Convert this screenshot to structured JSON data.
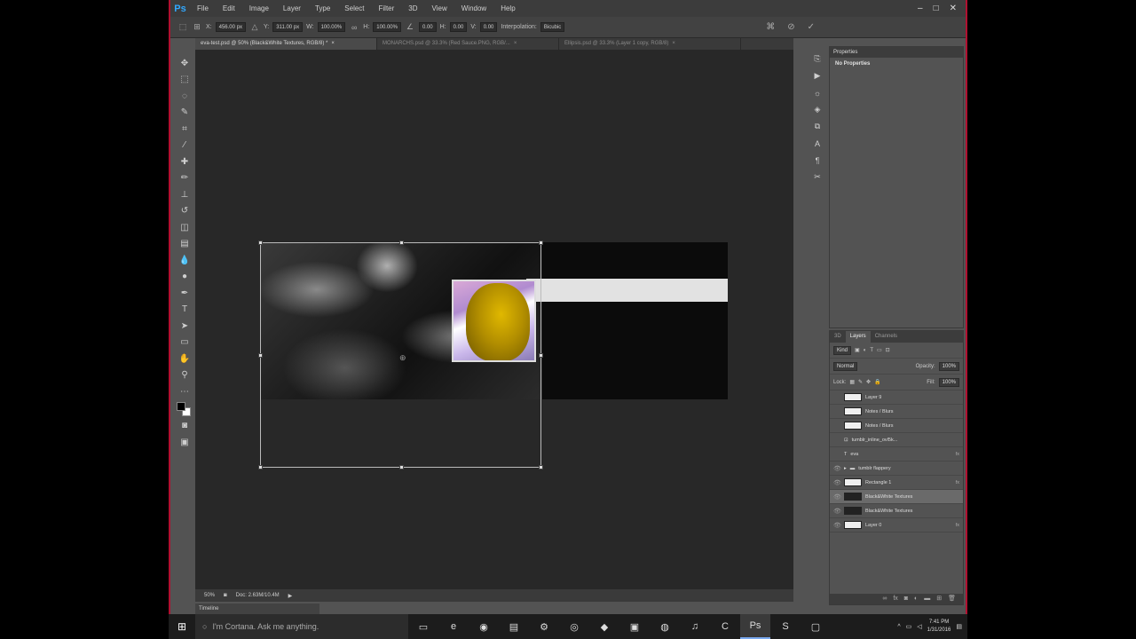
{
  "app": {
    "logo": "Ps"
  },
  "menu": [
    "File",
    "Edit",
    "Image",
    "Layer",
    "Type",
    "Select",
    "Filter",
    "3D",
    "View",
    "Window",
    "Help"
  ],
  "window_controls": [
    "–",
    "□",
    "✕"
  ],
  "options": {
    "x_label": "X:",
    "x_value": "456.00 px",
    "y_label": "Y:",
    "y_value": "311.00 px",
    "w_label": "W:",
    "w_value": "100.00%",
    "h_label": "H:",
    "h_value": "100.00%",
    "angle_value": "0.00",
    "hskew_label": "H:",
    "hskew_value": "0.00",
    "vskew_label": "V:",
    "vskew_value": "0.00",
    "interpolation_label": "Interpolation:",
    "interpolation_value": "Bicubic"
  },
  "tabs": [
    "eva-test.psd @ 50% (Black&White Textures, RGB/8) *",
    "MONARCHS.psd @ 33.3% (Red Sauce.PNG, RGB/...",
    "Ellipsis.psd @ 33.3% (Layer 1 copy, RGB/8)"
  ],
  "status": {
    "zoom": "50%",
    "doc": "Doc: 2.63M/10.4M"
  },
  "timeline_label": "Timeline",
  "properties": {
    "title": "Properties",
    "body": "No Properties"
  },
  "layers_panel": {
    "tabs": [
      "3D",
      "Layers",
      "Channels"
    ],
    "kind_label": "Kind",
    "blend_mode": "Normal",
    "opacity_label": "Opacity:",
    "opacity_value": "100%",
    "lock_label": "Lock:",
    "fill_label": "Fill:",
    "fill_value": "100%",
    "rows": [
      {
        "name": "Layer 9",
        "visible": false,
        "thumb": "white",
        "selected": false
      },
      {
        "name": "Notes / Blurs",
        "visible": false,
        "thumb": "white",
        "selected": false
      },
      {
        "name": "Notes / Blurs",
        "visible": false,
        "thumb": "white",
        "selected": false
      },
      {
        "name": "tumblr_inline_ovl5k...",
        "visible": false,
        "thumb": "white",
        "selected": false
      },
      {
        "name": "eva",
        "visible": false,
        "thumb": "text",
        "selected": false
      },
      {
        "name": "tumblr flappery",
        "visible": true,
        "thumb": "folder",
        "selected": false
      },
      {
        "name": "Rectangle 1",
        "visible": true,
        "thumb": "white",
        "selected": false
      },
      {
        "name": "Black&White Textures",
        "visible": true,
        "thumb": "dark",
        "selected": true
      },
      {
        "name": "Black&White Textures",
        "visible": true,
        "thumb": "dark",
        "selected": false
      },
      {
        "name": "Layer 0",
        "visible": true,
        "thumb": "white",
        "selected": false
      }
    ]
  },
  "taskbar": {
    "search_placeholder": "I'm Cortana. Ask me anything.",
    "time": "7:41 PM",
    "date": "1/31/2016"
  }
}
